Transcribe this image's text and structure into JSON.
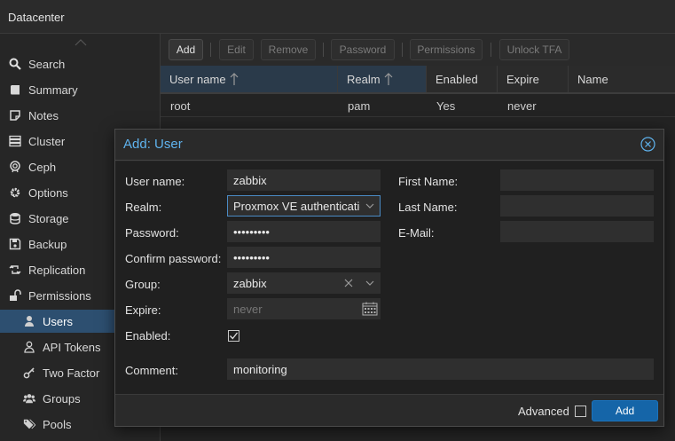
{
  "topbar": {
    "title": "Datacenter"
  },
  "sidebar": {
    "items": [
      {
        "label": "Search",
        "icon": "search-icon"
      },
      {
        "label": "Summary",
        "icon": "book-icon"
      },
      {
        "label": "Notes",
        "icon": "note-icon"
      },
      {
        "label": "Cluster",
        "icon": "server-icon"
      },
      {
        "label": "Ceph",
        "icon": "ceph-icon"
      },
      {
        "label": "Options",
        "icon": "gear-icon"
      },
      {
        "label": "Storage",
        "icon": "database-icon"
      },
      {
        "label": "Backup",
        "icon": "floppy-icon"
      },
      {
        "label": "Replication",
        "icon": "retweet-icon"
      },
      {
        "label": "Permissions",
        "icon": "unlock-icon"
      },
      {
        "label": "Users",
        "icon": "user-icon"
      },
      {
        "label": "API Tokens",
        "icon": "user-o-icon"
      },
      {
        "label": "Two Factor",
        "icon": "key-icon"
      },
      {
        "label": "Groups",
        "icon": "users-icon"
      },
      {
        "label": "Pools",
        "icon": "tags-icon"
      }
    ]
  },
  "toolbar": {
    "add": "Add",
    "edit": "Edit",
    "remove": "Remove",
    "password": "Password",
    "permissions": "Permissions",
    "unlock_tfa": "Unlock TFA"
  },
  "grid": {
    "columns": [
      "User name",
      "Realm",
      "Enabled",
      "Expire",
      "Name"
    ],
    "rows": [
      [
        "root",
        "pam",
        "Yes",
        "never",
        ""
      ]
    ]
  },
  "dialog": {
    "title": "Add: User",
    "labels": {
      "username": "User name:",
      "realm": "Realm:",
      "password": "Password:",
      "confirm": "Confirm password:",
      "group": "Group:",
      "expire": "Expire:",
      "enabled": "Enabled:",
      "comment": "Comment:",
      "firstname": "First Name:",
      "lastname": "Last Name:",
      "email": "E-Mail:"
    },
    "values": {
      "username": "zabbix",
      "realm": "Proxmox VE authentication server",
      "password": "•••••••••",
      "confirm": "•••••••••",
      "group": "zabbix",
      "expire_placeholder": "never",
      "enabled": true,
      "comment": "monitoring",
      "firstname": "",
      "lastname": "",
      "email": ""
    },
    "footer": {
      "advanced": "Advanced",
      "add": "Add"
    }
  },
  "colors": {
    "accent": "#1565a8",
    "title_blue": "#5fb3ee",
    "active_nav": "#2d4f70"
  }
}
